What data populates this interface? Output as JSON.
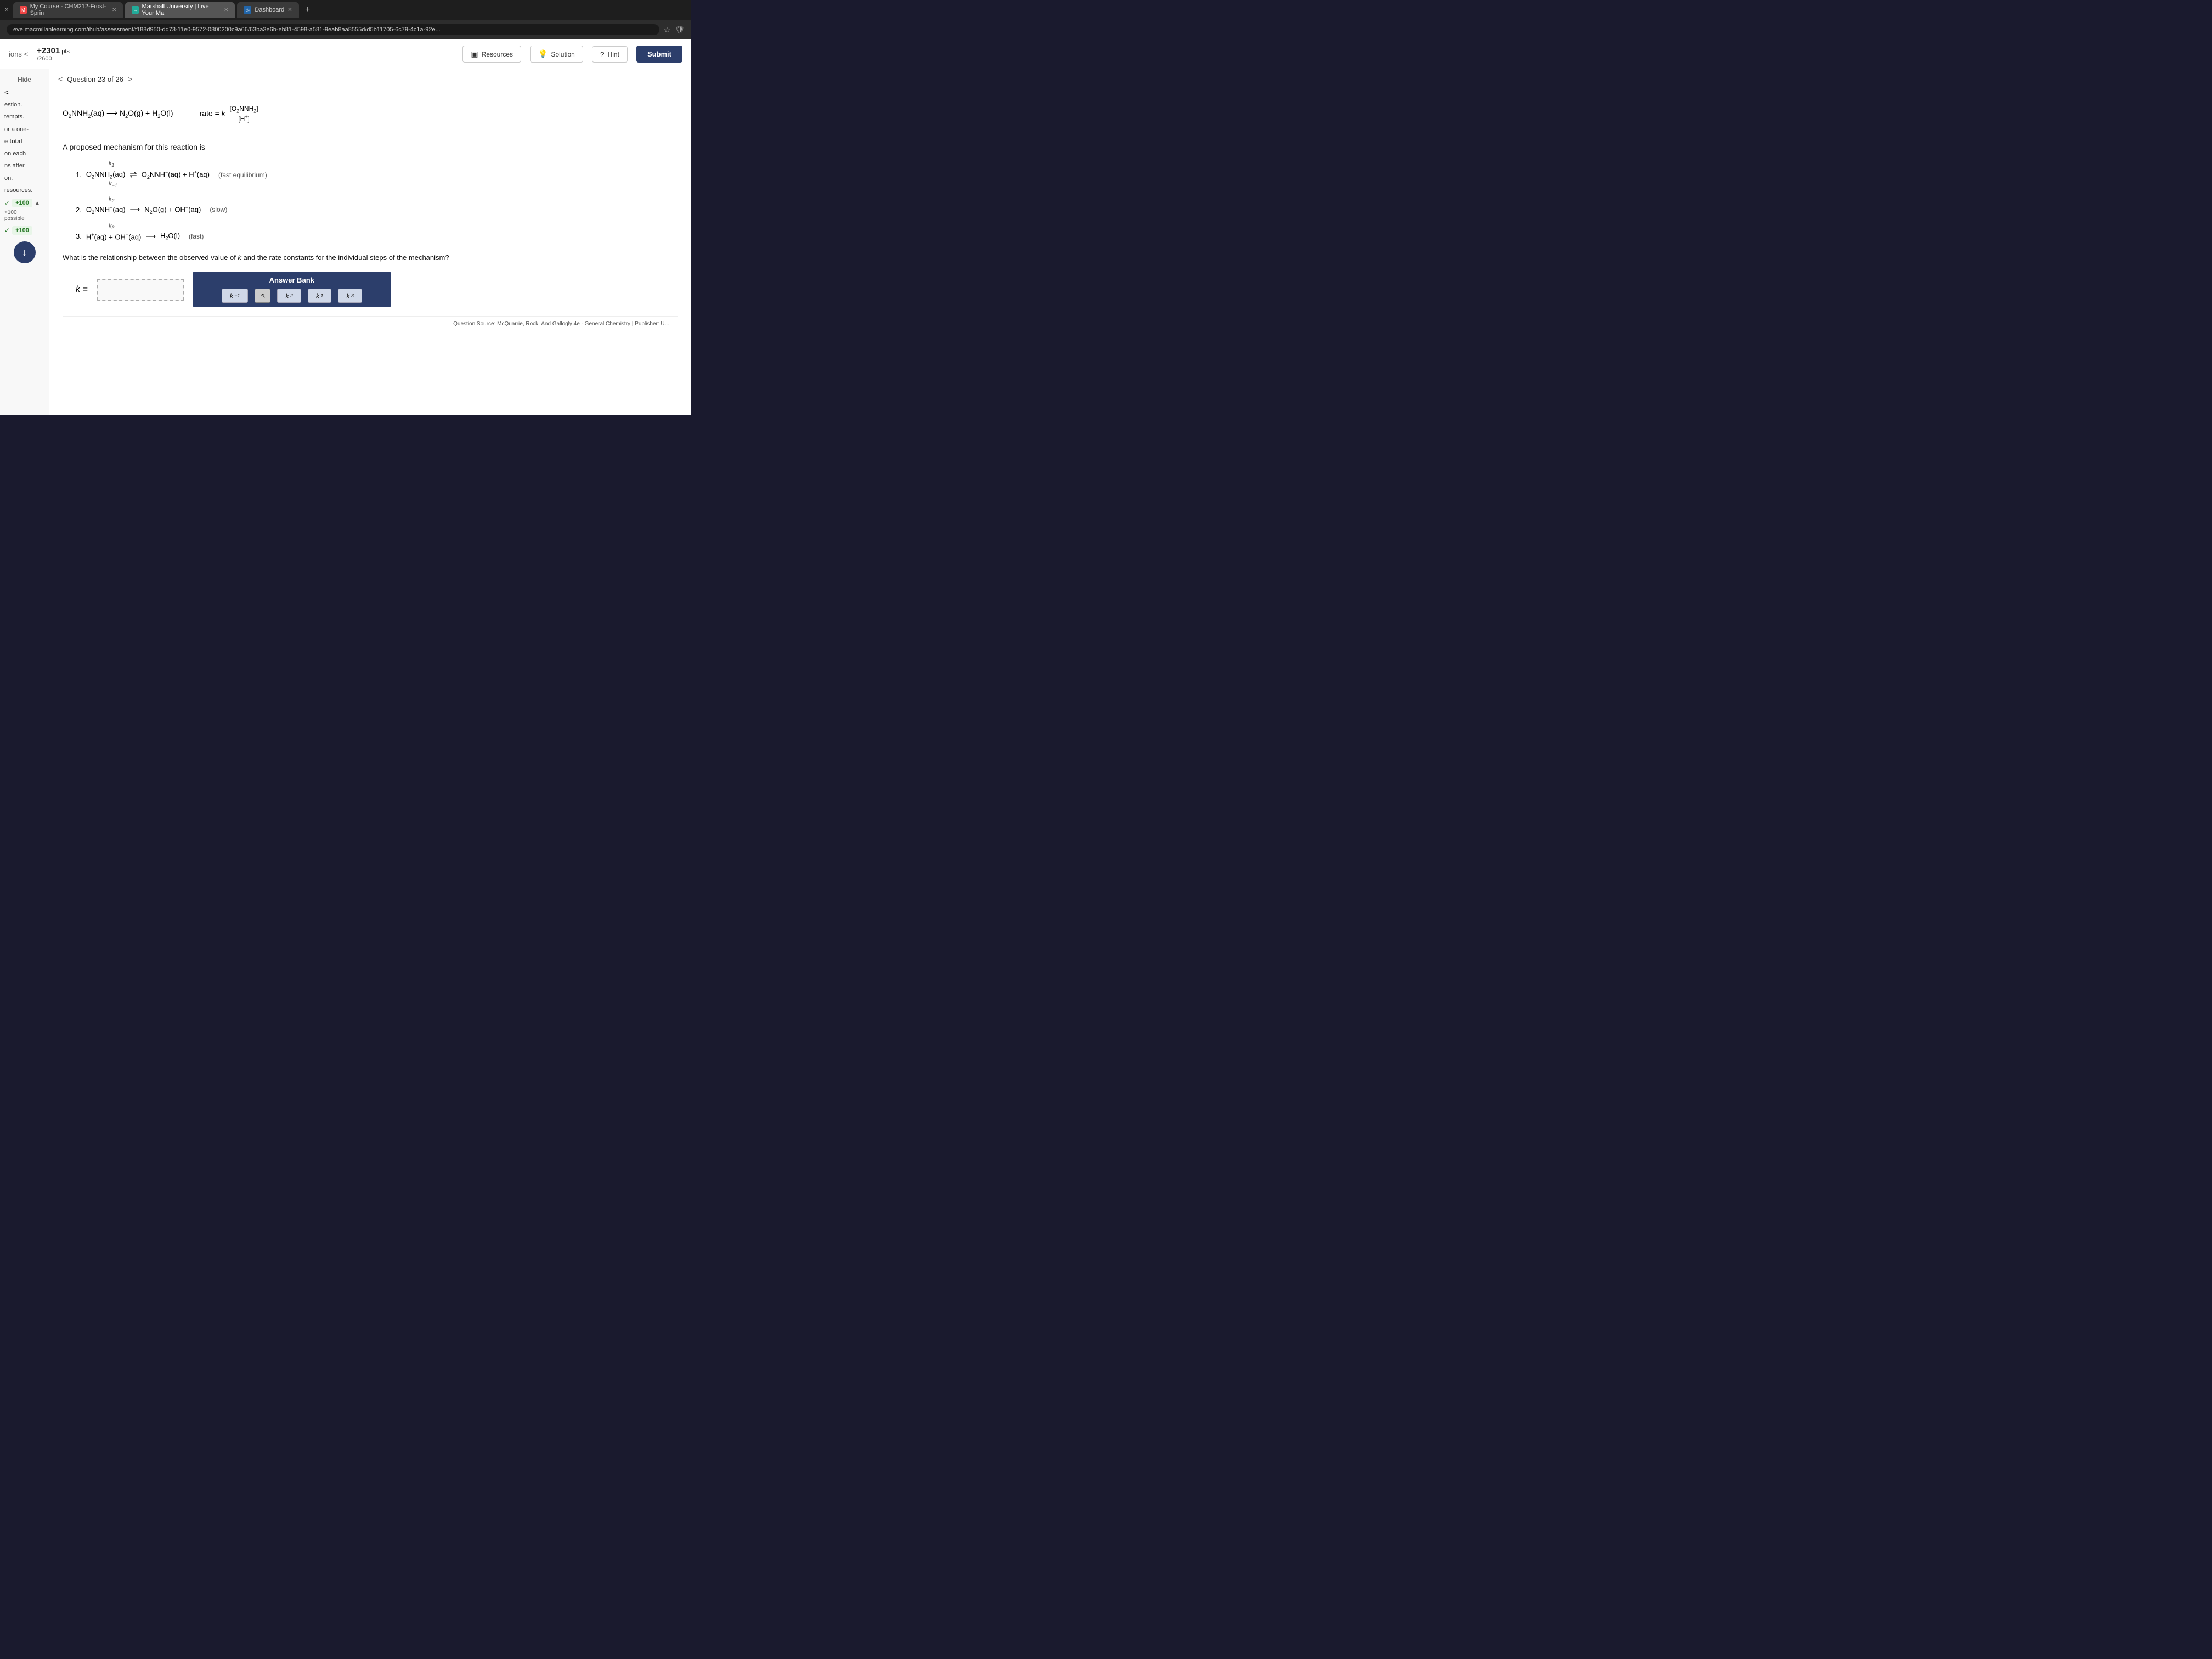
{
  "browser": {
    "tabs": [
      {
        "id": "tab1",
        "label": "My Course - CHM212-Frost-Sprin",
        "active": false,
        "icon": "M"
      },
      {
        "id": "tab2",
        "label": "Marshall University | Live Your Ma",
        "active": true,
        "icon": "→"
      },
      {
        "id": "tab3",
        "label": "Dashboard",
        "active": false,
        "icon": "◎"
      }
    ],
    "address": "eve.macmillanlearning.com/ihub/assessment/f188d950-dd73-11e0-9572-0800200c9a66/63ba3e6b-eb81-4598-a581-9eab8aa8555d/d5b11705-6c79-4c1a-92e..."
  },
  "toolbar": {
    "points_value": "+2301",
    "points_suffix": " pts",
    "points_total": "/2600",
    "resources_label": "Resources",
    "solution_label": "Solution",
    "hint_label": "Hint",
    "submit_label": "Submit"
  },
  "sidebar": {
    "hide_label": "Hide",
    "partial_label": "ions",
    "score_plus": "+100",
    "score_possible": "+100",
    "score_possible_label": "possible",
    "score_plus2": "+100"
  },
  "question": {
    "header": "Question 23 of 26",
    "proposed_text": "A proposed mechanism for this reaction is",
    "main_equation": "O₂NNH₂(aq) → N₂O(g) + H₂O(l)",
    "rate_equation_text": "rate = k",
    "rate_num": "[O₂NNH₂]",
    "rate_den": "[H⁺]",
    "step1_k": "k₁",
    "step1_km": "k₋₁",
    "step1_eq": "O₂NNH₂(aq) ⇌ O₂NNH⁻(aq) + H⁺(aq)",
    "step1_tag": "(fast equilibrium)",
    "step2_k": "k₂",
    "step2_eq": "O₂NNH⁻(aq) → N₂O(g) + OH⁻(aq)",
    "step2_tag": "(slow)",
    "step3_k": "k₃",
    "step3_eq": "H⁺(aq) + OH⁻(aq) → H₂O(l)",
    "step3_tag": "(fast)",
    "question_text": "What is the relationship between the observed value of k and the rate constants for the individual steps of the mechanism?",
    "k_label": "k =",
    "answer_bank_title": "Answer Bank",
    "answer_items": [
      {
        "id": "a1",
        "label": "k₋₁",
        "k": "k",
        "sub": "−1"
      },
      {
        "id": "a2",
        "label": "k₂",
        "k": "k",
        "sub": "2"
      },
      {
        "id": "a3",
        "label": "k₁",
        "k": "k",
        "sub": "1"
      },
      {
        "id": "a4",
        "label": "k₃",
        "k": "k",
        "sub": "3"
      }
    ],
    "source_text": "Question Source: McQuarrie, Rock, And Gallogly 4e · General Chemistry  |  Publisher: U..."
  }
}
